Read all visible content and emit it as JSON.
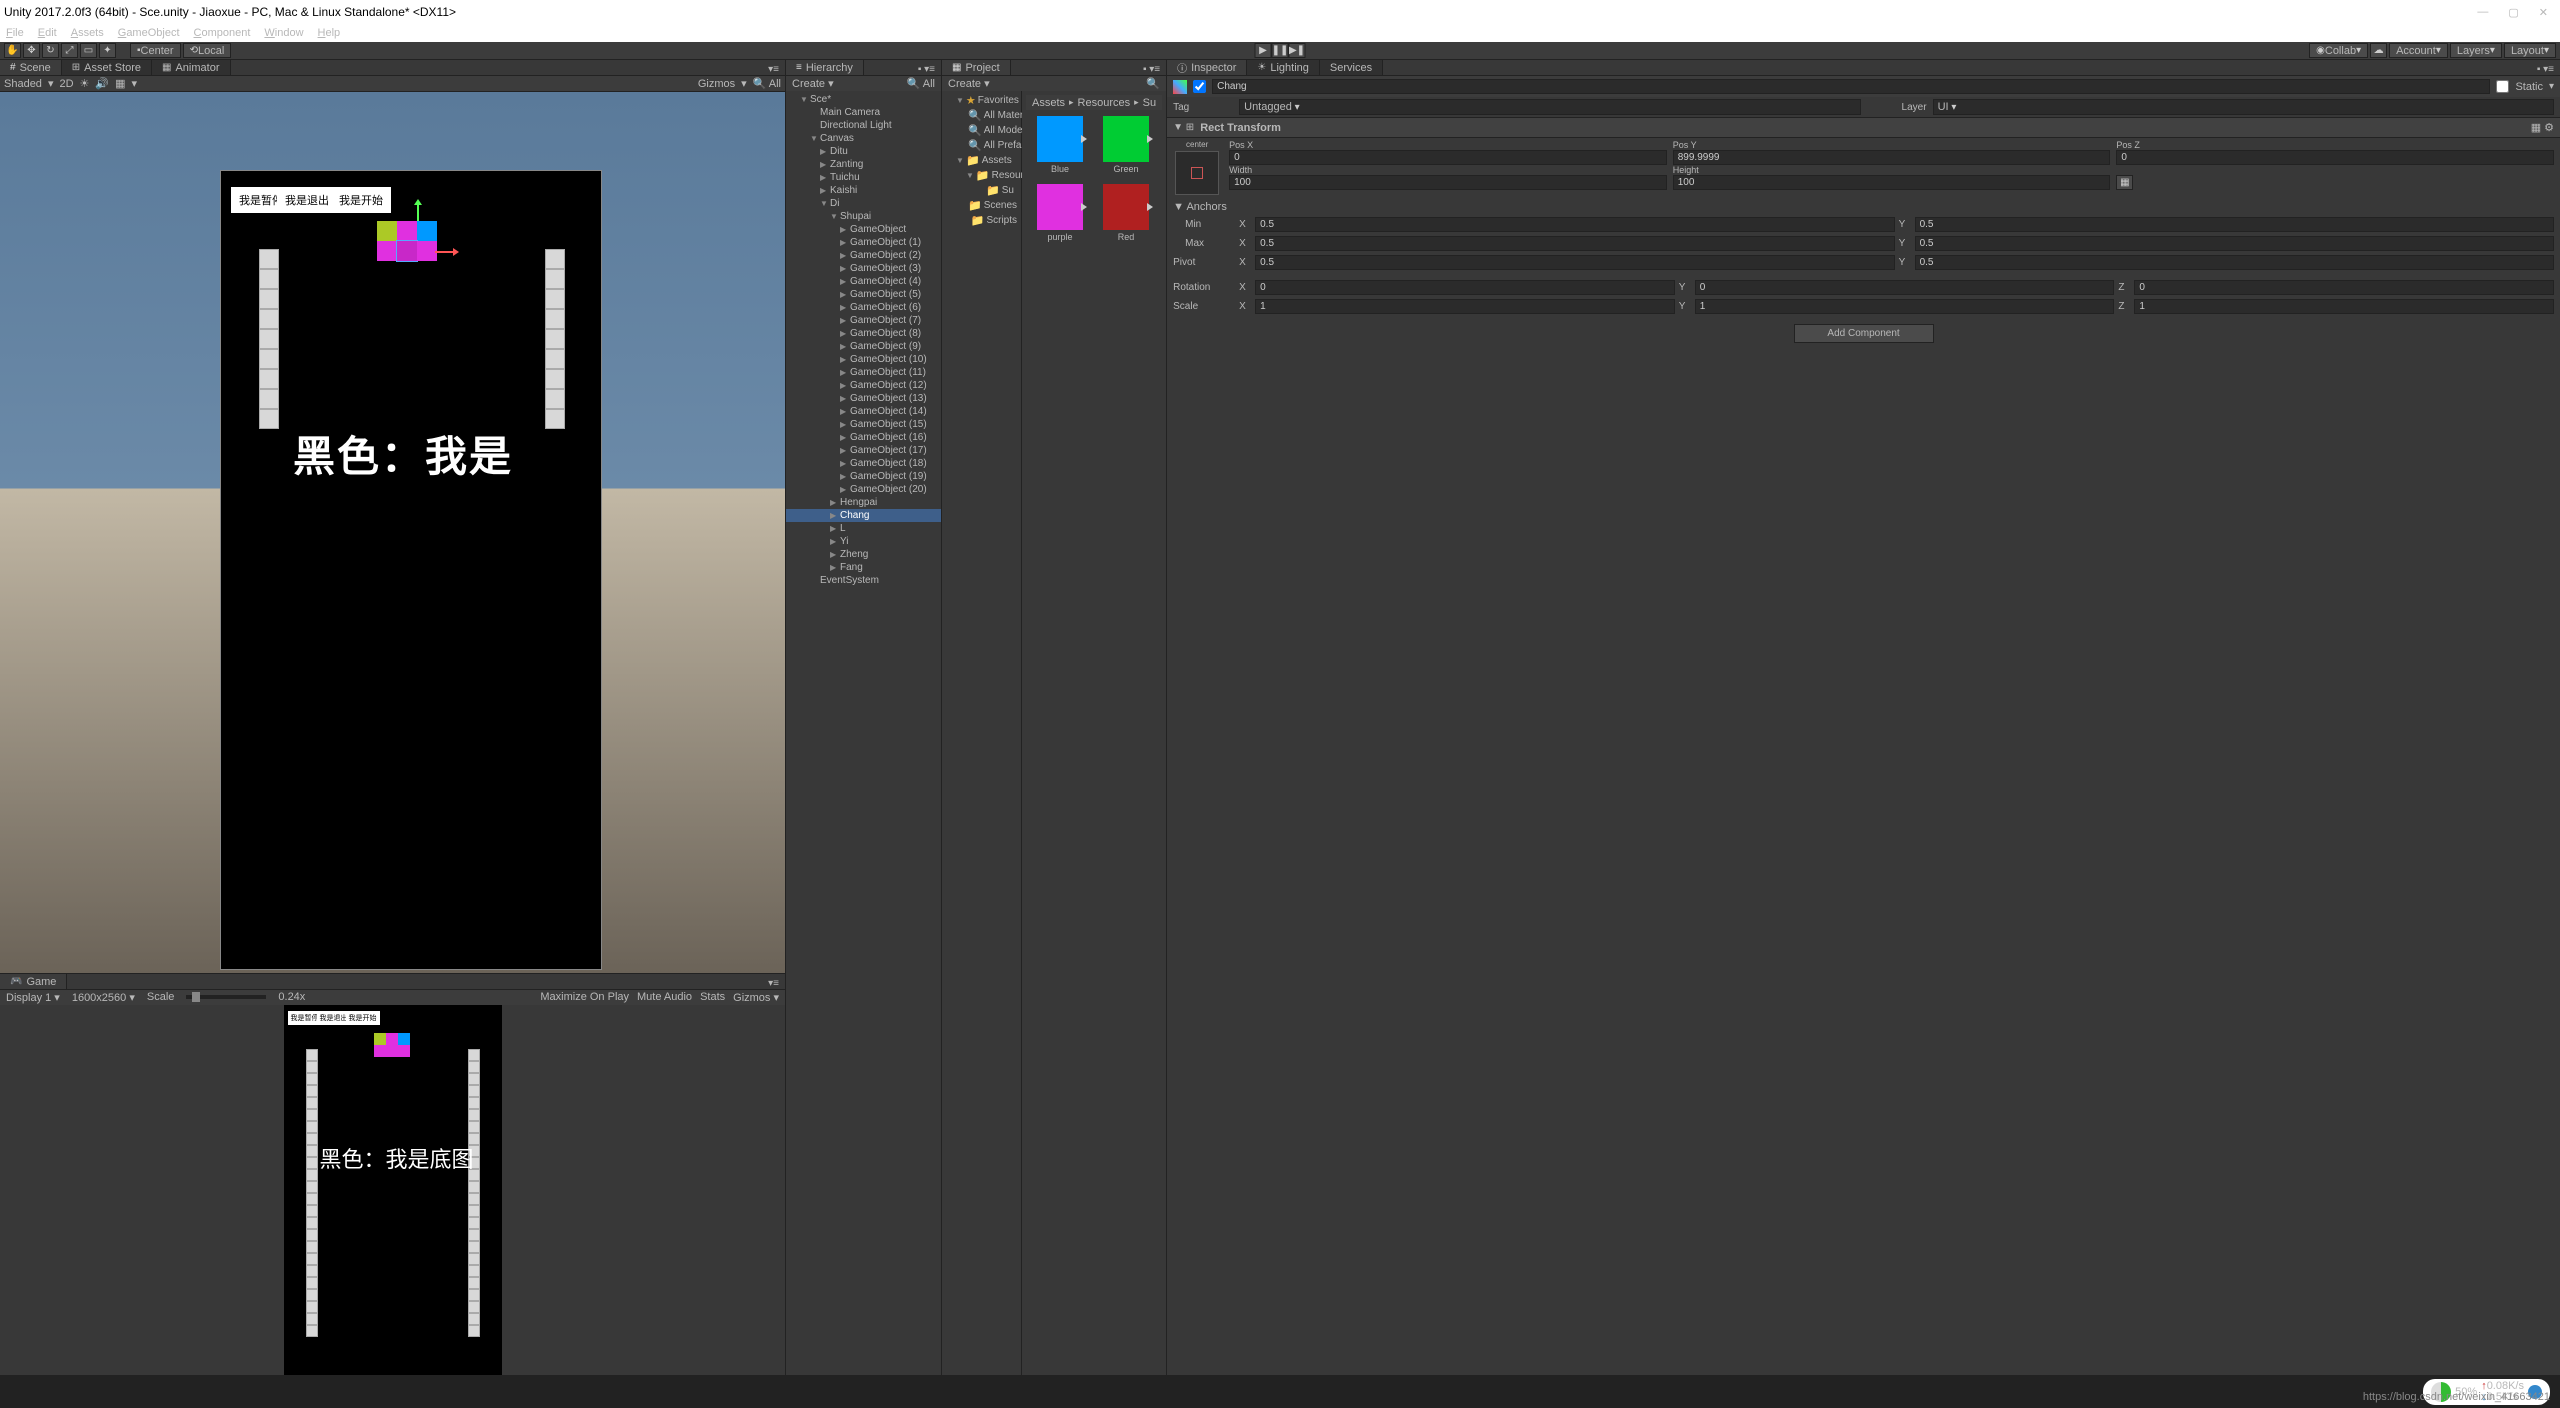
{
  "window": {
    "title": "Unity 2017.2.0f3 (64bit) - Sce.unity - Jiaoxue - PC, Mac & Linux Standalone* <DX11>",
    "min": "—",
    "max": "▢",
    "close": "✕"
  },
  "menu": [
    "File",
    "Edit",
    "Assets",
    "GameObject",
    "Component",
    "Window",
    "Help"
  ],
  "toolbar": {
    "pivot": "Center",
    "space": "Local",
    "collab": "Collab",
    "account": "Account",
    "layers": "Layers",
    "layout": "Layout"
  },
  "scene": {
    "tab_scene": "Scene",
    "tab_asset": "Asset Store",
    "tab_anim": "Animator",
    "shaded": "Shaded",
    "mode2d": "2D",
    "gizmos": "Gizmos"
  },
  "game": {
    "tab": "Game",
    "display": "Display 1",
    "res": "1600x2560",
    "scale": "Scale",
    "scale_val": "0.24x",
    "max": "Maximize On Play",
    "mute": "Mute Audio",
    "stats": "Stats",
    "gizmos": "Gizmos"
  },
  "canvas_ui": {
    "btn1": "我是暂停",
    "btn2": "我是退出",
    "btn3": "我是开始",
    "big_text_scene": "黑色：我是",
    "big_text_game": "黑色：我是底图"
  },
  "hierarchy": {
    "tab": "Hierarchy",
    "create": "Create",
    "items": [
      {
        "name": "Sce*",
        "lvl": 1,
        "fold": "▼"
      },
      {
        "name": "Main Camera",
        "lvl": 2,
        "fold": ""
      },
      {
        "name": "Directional Light",
        "lvl": 2,
        "fold": ""
      },
      {
        "name": "Canvas",
        "lvl": 2,
        "fold": "▼"
      },
      {
        "name": "Ditu",
        "lvl": 3,
        "fold": "▶"
      },
      {
        "name": "Zanting",
        "lvl": 3,
        "fold": "▶"
      },
      {
        "name": "Tuichu",
        "lvl": 3,
        "fold": "▶"
      },
      {
        "name": "Kaishi",
        "lvl": 3,
        "fold": "▶"
      },
      {
        "name": "Di",
        "lvl": 3,
        "fold": "▼"
      },
      {
        "name": "Shupai",
        "lvl": 4,
        "fold": "▼"
      },
      {
        "name": "GameObject",
        "lvl": 5,
        "fold": "▶"
      },
      {
        "name": "GameObject (1)",
        "lvl": 5,
        "fold": "▶"
      },
      {
        "name": "GameObject (2)",
        "lvl": 5,
        "fold": "▶"
      },
      {
        "name": "GameObject (3)",
        "lvl": 5,
        "fold": "▶"
      },
      {
        "name": "GameObject (4)",
        "lvl": 5,
        "fold": "▶"
      },
      {
        "name": "GameObject (5)",
        "lvl": 5,
        "fold": "▶"
      },
      {
        "name": "GameObject (6)",
        "lvl": 5,
        "fold": "▶"
      },
      {
        "name": "GameObject (7)",
        "lvl": 5,
        "fold": "▶"
      },
      {
        "name": "GameObject (8)",
        "lvl": 5,
        "fold": "▶"
      },
      {
        "name": "GameObject (9)",
        "lvl": 5,
        "fold": "▶"
      },
      {
        "name": "GameObject (10)",
        "lvl": 5,
        "fold": "▶"
      },
      {
        "name": "GameObject (11)",
        "lvl": 5,
        "fold": "▶"
      },
      {
        "name": "GameObject (12)",
        "lvl": 5,
        "fold": "▶"
      },
      {
        "name": "GameObject (13)",
        "lvl": 5,
        "fold": "▶"
      },
      {
        "name": "GameObject (14)",
        "lvl": 5,
        "fold": "▶"
      },
      {
        "name": "GameObject (15)",
        "lvl": 5,
        "fold": "▶"
      },
      {
        "name": "GameObject (16)",
        "lvl": 5,
        "fold": "▶"
      },
      {
        "name": "GameObject (17)",
        "lvl": 5,
        "fold": "▶"
      },
      {
        "name": "GameObject (18)",
        "lvl": 5,
        "fold": "▶"
      },
      {
        "name": "GameObject (19)",
        "lvl": 5,
        "fold": "▶"
      },
      {
        "name": "GameObject (20)",
        "lvl": 5,
        "fold": "▶"
      },
      {
        "name": "Hengpai",
        "lvl": 4,
        "fold": "▶"
      },
      {
        "name": "Chang",
        "lvl": 4,
        "fold": "▶",
        "selected": true
      },
      {
        "name": "L",
        "lvl": 4,
        "fold": "▶"
      },
      {
        "name": "Yi",
        "lvl": 4,
        "fold": "▶"
      },
      {
        "name": "Zheng",
        "lvl": 4,
        "fold": "▶"
      },
      {
        "name": "Fang",
        "lvl": 4,
        "fold": "▶"
      },
      {
        "name": "EventSystem",
        "lvl": 2,
        "fold": ""
      }
    ]
  },
  "project": {
    "tab": "Project",
    "create": "Create",
    "breadcrumb": [
      "Assets",
      "Resources",
      "Su"
    ],
    "tree": [
      {
        "name": "Favorites",
        "lvl": 1,
        "fold": "▼",
        "icon": "star"
      },
      {
        "name": "All Materials",
        "lvl": 2,
        "icon": "search"
      },
      {
        "name": "All Models",
        "lvl": 2,
        "icon": "search"
      },
      {
        "name": "All Prefabs",
        "lvl": 2,
        "icon": "search"
      },
      {
        "name": "Assets",
        "lvl": 1,
        "fold": "▼",
        "icon": "folder"
      },
      {
        "name": "Resources",
        "lvl": 2,
        "fold": "▼",
        "icon": "folder"
      },
      {
        "name": "Su",
        "lvl": 3,
        "icon": "folder"
      },
      {
        "name": "Scenes",
        "lvl": 2,
        "icon": "folder"
      },
      {
        "name": "Scripts",
        "lvl": 2,
        "icon": "folder"
      }
    ],
    "assets": [
      {
        "name": "Blue",
        "color": "#0099ff"
      },
      {
        "name": "Green",
        "color": "#00cc33"
      },
      {
        "name": "purple",
        "color": "#e030e0"
      },
      {
        "name": "Red",
        "color": "#b02020"
      }
    ]
  },
  "inspector": {
    "tab_insp": "Inspector",
    "tab_light": "Lighting",
    "tab_serv": "Services",
    "obj_name": "Chang",
    "static": "Static",
    "tag_lbl": "Tag",
    "tag_val": "Untagged",
    "layer_lbl": "Layer",
    "layer_val": "UI",
    "rect_transform": "Rect Transform",
    "anchor_preset": "center",
    "pos_x_lbl": "Pos X",
    "pos_y_lbl": "Pos Y",
    "pos_z_lbl": "Pos Z",
    "pos_x": "0",
    "pos_y": "899.9999",
    "pos_z": "0",
    "width_lbl": "Width",
    "height_lbl": "Height",
    "width": "100",
    "height": "100",
    "anchors": "Anchors",
    "min_lbl": "Min",
    "max_lbl": "Max",
    "pivot_lbl": "Pivot",
    "min_x": "0.5",
    "min_y": "0.5",
    "max_x": "0.5",
    "max_y": "0.5",
    "pivot_x": "0.5",
    "pivot_y": "0.5",
    "rotation_lbl": "Rotation",
    "rot_x": "0",
    "rot_y": "0",
    "rot_z": "0",
    "scale_lbl": "Scale",
    "scl_x": "1",
    "scl_y": "1",
    "scl_z": "1",
    "add_component": "Add Component"
  },
  "netmon": {
    "pct": "50%",
    "down": "0.08K/s",
    "up": "0.5K/s"
  },
  "watermark": "https://blog.csdn.net/weixin_41663421"
}
